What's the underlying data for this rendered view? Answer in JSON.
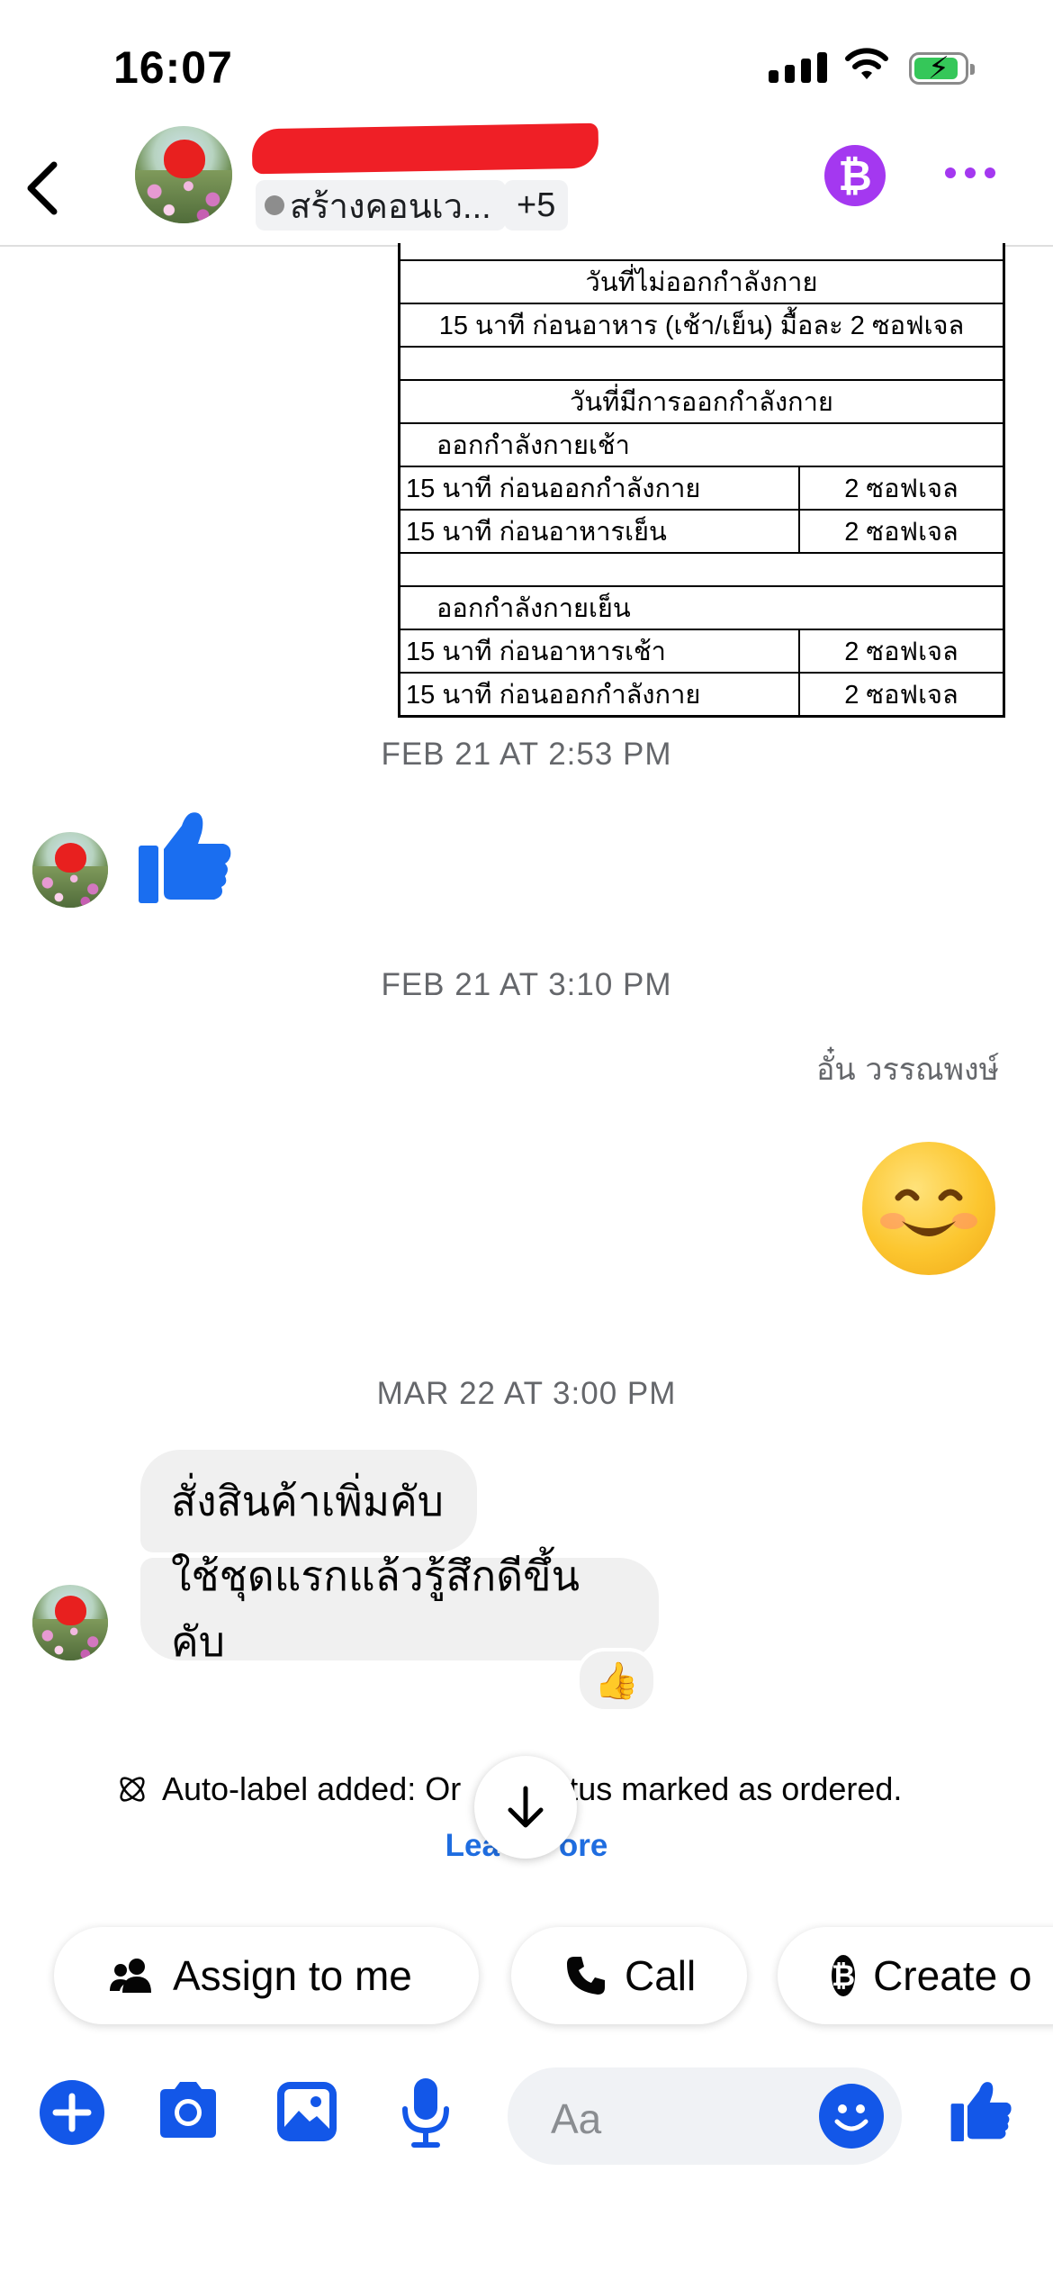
{
  "status_bar": {
    "time": "16:07"
  },
  "header": {
    "tag_label": "สร้างคอนเว...",
    "more_count": "+5",
    "bitcoin_symbol": "₿"
  },
  "attachment_table": {
    "rows": [
      {
        "type": "span",
        "text": "วันที่ไม่ออกกำลังกาย"
      },
      {
        "type": "span",
        "text": "15 นาที ก่อนอาหาร (เช้า/เย็น) มื้อละ 2 ซอฟเจล"
      },
      {
        "type": "span",
        "text": ""
      },
      {
        "type": "span",
        "text": "วันที่มีการออกกำลังกาย"
      },
      {
        "type": "indent",
        "text": "ออกกำลังกายเช้า"
      },
      {
        "type": "pair",
        "left": "15 นาที ก่อนออกกำลังกาย",
        "right": "2 ซอฟเจล"
      },
      {
        "type": "pair",
        "left": "15 นาที ก่อนอาหารเย็น",
        "right": "2 ซอฟเจล"
      },
      {
        "type": "span",
        "text": ""
      },
      {
        "type": "indent",
        "text": "ออกกำลังกายเย็น"
      },
      {
        "type": "pair",
        "left": "15 นาที ก่อนอาหารเช้า",
        "right": "2 ซอฟเจล"
      },
      {
        "type": "pair",
        "left": "15 นาที ก่อนออกกำลังกาย",
        "right": "2 ซอฟเจล"
      }
    ]
  },
  "timestamps": {
    "t1": "FEB 21 AT 2:53 PM",
    "t2": "FEB 21 AT 3:10 PM",
    "t3": "MAR 22 AT 3:00 PM"
  },
  "messages": {
    "sender_name": "อั๋น วรรณพงษ์",
    "bubble1": "สั่งสินค้าเพิ่มคับ",
    "bubble2": "ใช้ชุดแรกแล้วรู้สึกดีขึ้นคับ",
    "reaction": "👍"
  },
  "system": {
    "auto_label_prefix": "Auto-label added: Or",
    "auto_label_suffix": "tus marked as ordered.",
    "learn_prefix": "Lea",
    "learn_suffix": "ore"
  },
  "actions": {
    "assign": "Assign to me",
    "call": "Call",
    "create": "Create o"
  },
  "composer": {
    "placeholder": "Aa"
  },
  "colors": {
    "accent": "#1357e8",
    "purple": "#a438f0",
    "link": "#1f6de0"
  },
  "icons": [
    "back-chevron-icon",
    "bitcoin-icon",
    "more-icon",
    "thumbs-up-icon",
    "smile-emoji",
    "arrow-down-icon",
    "people-icon",
    "phone-icon",
    "plus-icon",
    "camera-icon",
    "image-icon",
    "mic-icon",
    "emoji-icon"
  ]
}
